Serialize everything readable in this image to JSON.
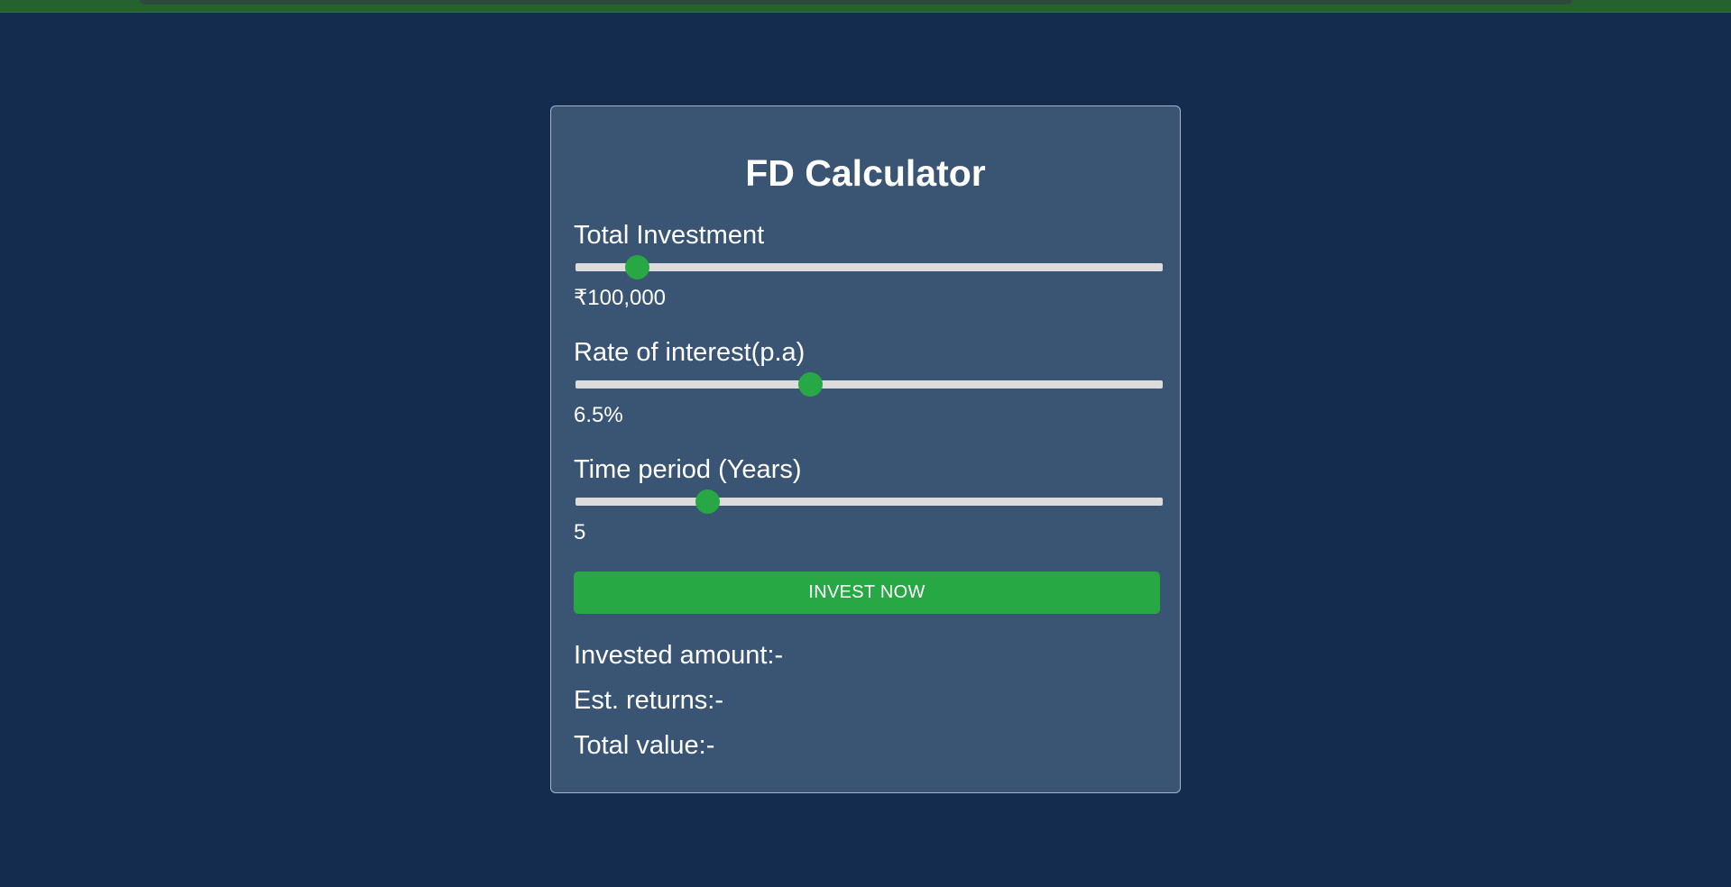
{
  "calculator": {
    "title": "FD Calculator",
    "investment": {
      "label": "Total Investment",
      "value_text": "₹100,000",
      "slider_fraction": 0.105
    },
    "interest": {
      "label": "Rate of interest(p.a)",
      "value_text": "6.5%",
      "slider_fraction": 0.4
    },
    "period": {
      "label": "Time period (Years)",
      "value_text": "5",
      "slider_fraction": 0.225
    },
    "invest_button_label": "INVEST NOW",
    "results": {
      "invested_amount": "Invested amount:-",
      "est_returns": "Est. returns:-",
      "total_value": "Total value:-"
    }
  },
  "colors": {
    "page_background": "#142c4d",
    "card_background": "#3a5474",
    "accent_green": "#28a745",
    "slider_track": "#dcdcdc",
    "text": "#ffffff"
  }
}
